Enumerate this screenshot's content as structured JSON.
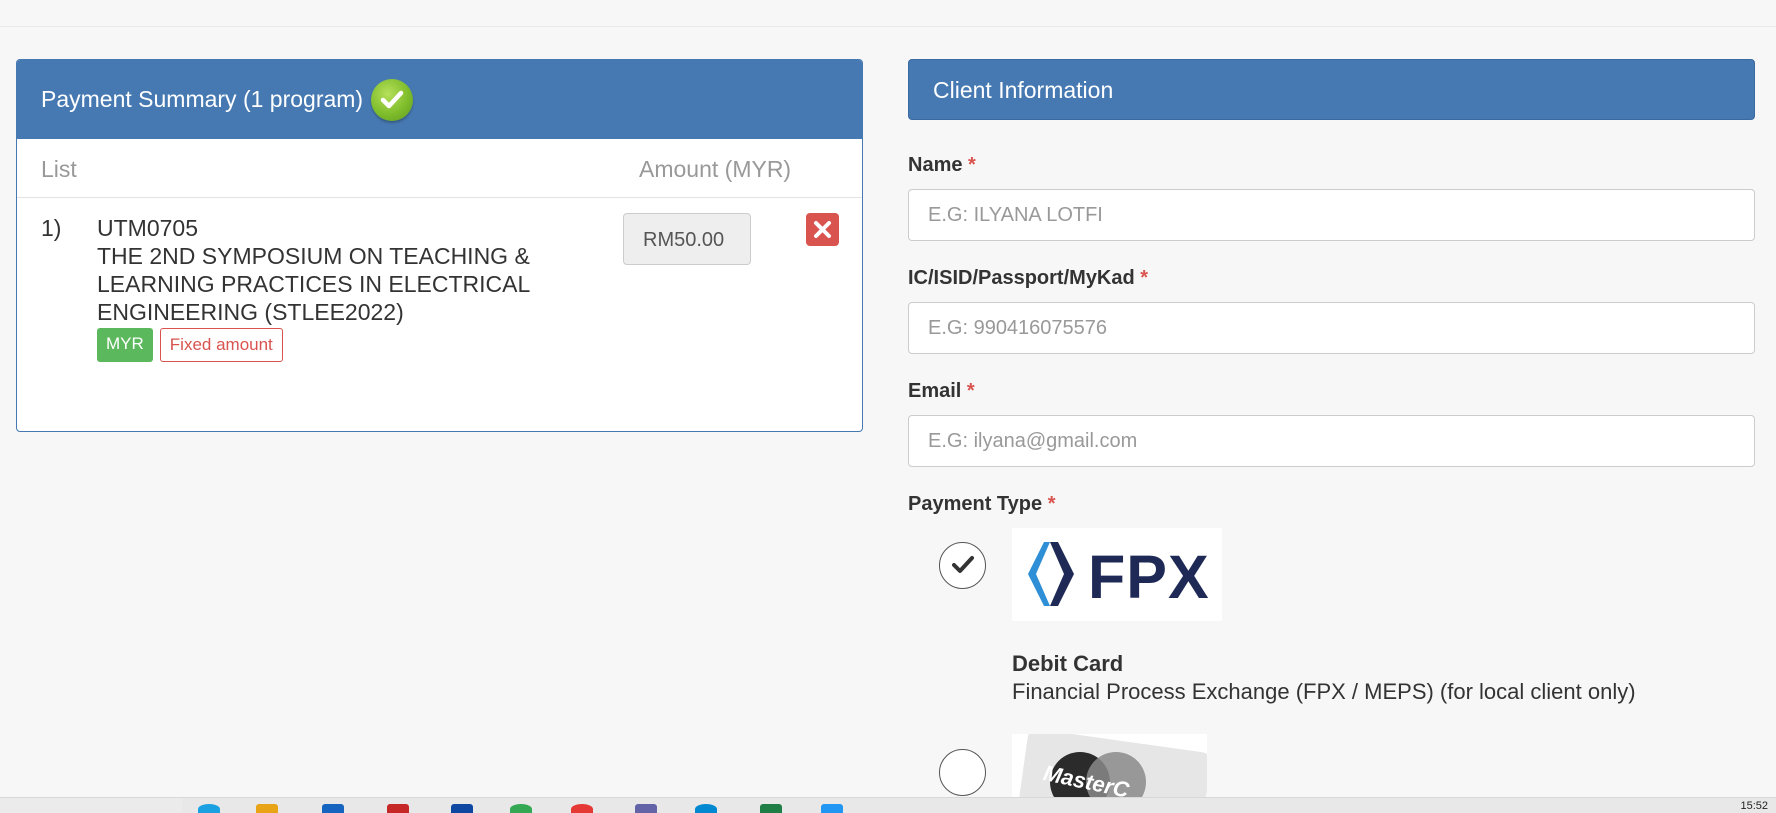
{
  "summary": {
    "title": "Payment Summary (1 program)",
    "col_list": "List",
    "col_amount": "Amount (MYR)",
    "items": [
      {
        "num": "1)",
        "code": "UTM0705",
        "title": "THE 2ND SYMPOSIUM ON TEACHING & LEARNING PRACTICES IN ELECTRICAL ENGINEERING (STLEE2022)",
        "currency_badge": "MYR",
        "type_badge": "Fixed amount",
        "amount": "RM50.00"
      }
    ]
  },
  "client": {
    "title": "Client Information",
    "name_label": "Name",
    "name_placeholder": "E.G: ILYANA LOTFI",
    "ic_label": "IC/ISID/Passport/MyKad",
    "ic_placeholder": "E.G: 990416075576",
    "email_label": "Email",
    "email_placeholder": "E.G: ilyana@gmail.com",
    "payment_type_label": "Payment Type",
    "required_mark": "*",
    "options": [
      {
        "logo_text": "FPX",
        "title": "Debit Card",
        "description": "Financial Process Exchange (FPX / MEPS) (for local client only)",
        "selected": true
      },
      {
        "logo_text": "MasterC",
        "selected": false
      }
    ]
  },
  "taskbar": {
    "clock": "15:52"
  },
  "colors": {
    "panel_header": "#4679b2",
    "danger": "#d9534f",
    "success": "#5cb85c"
  }
}
